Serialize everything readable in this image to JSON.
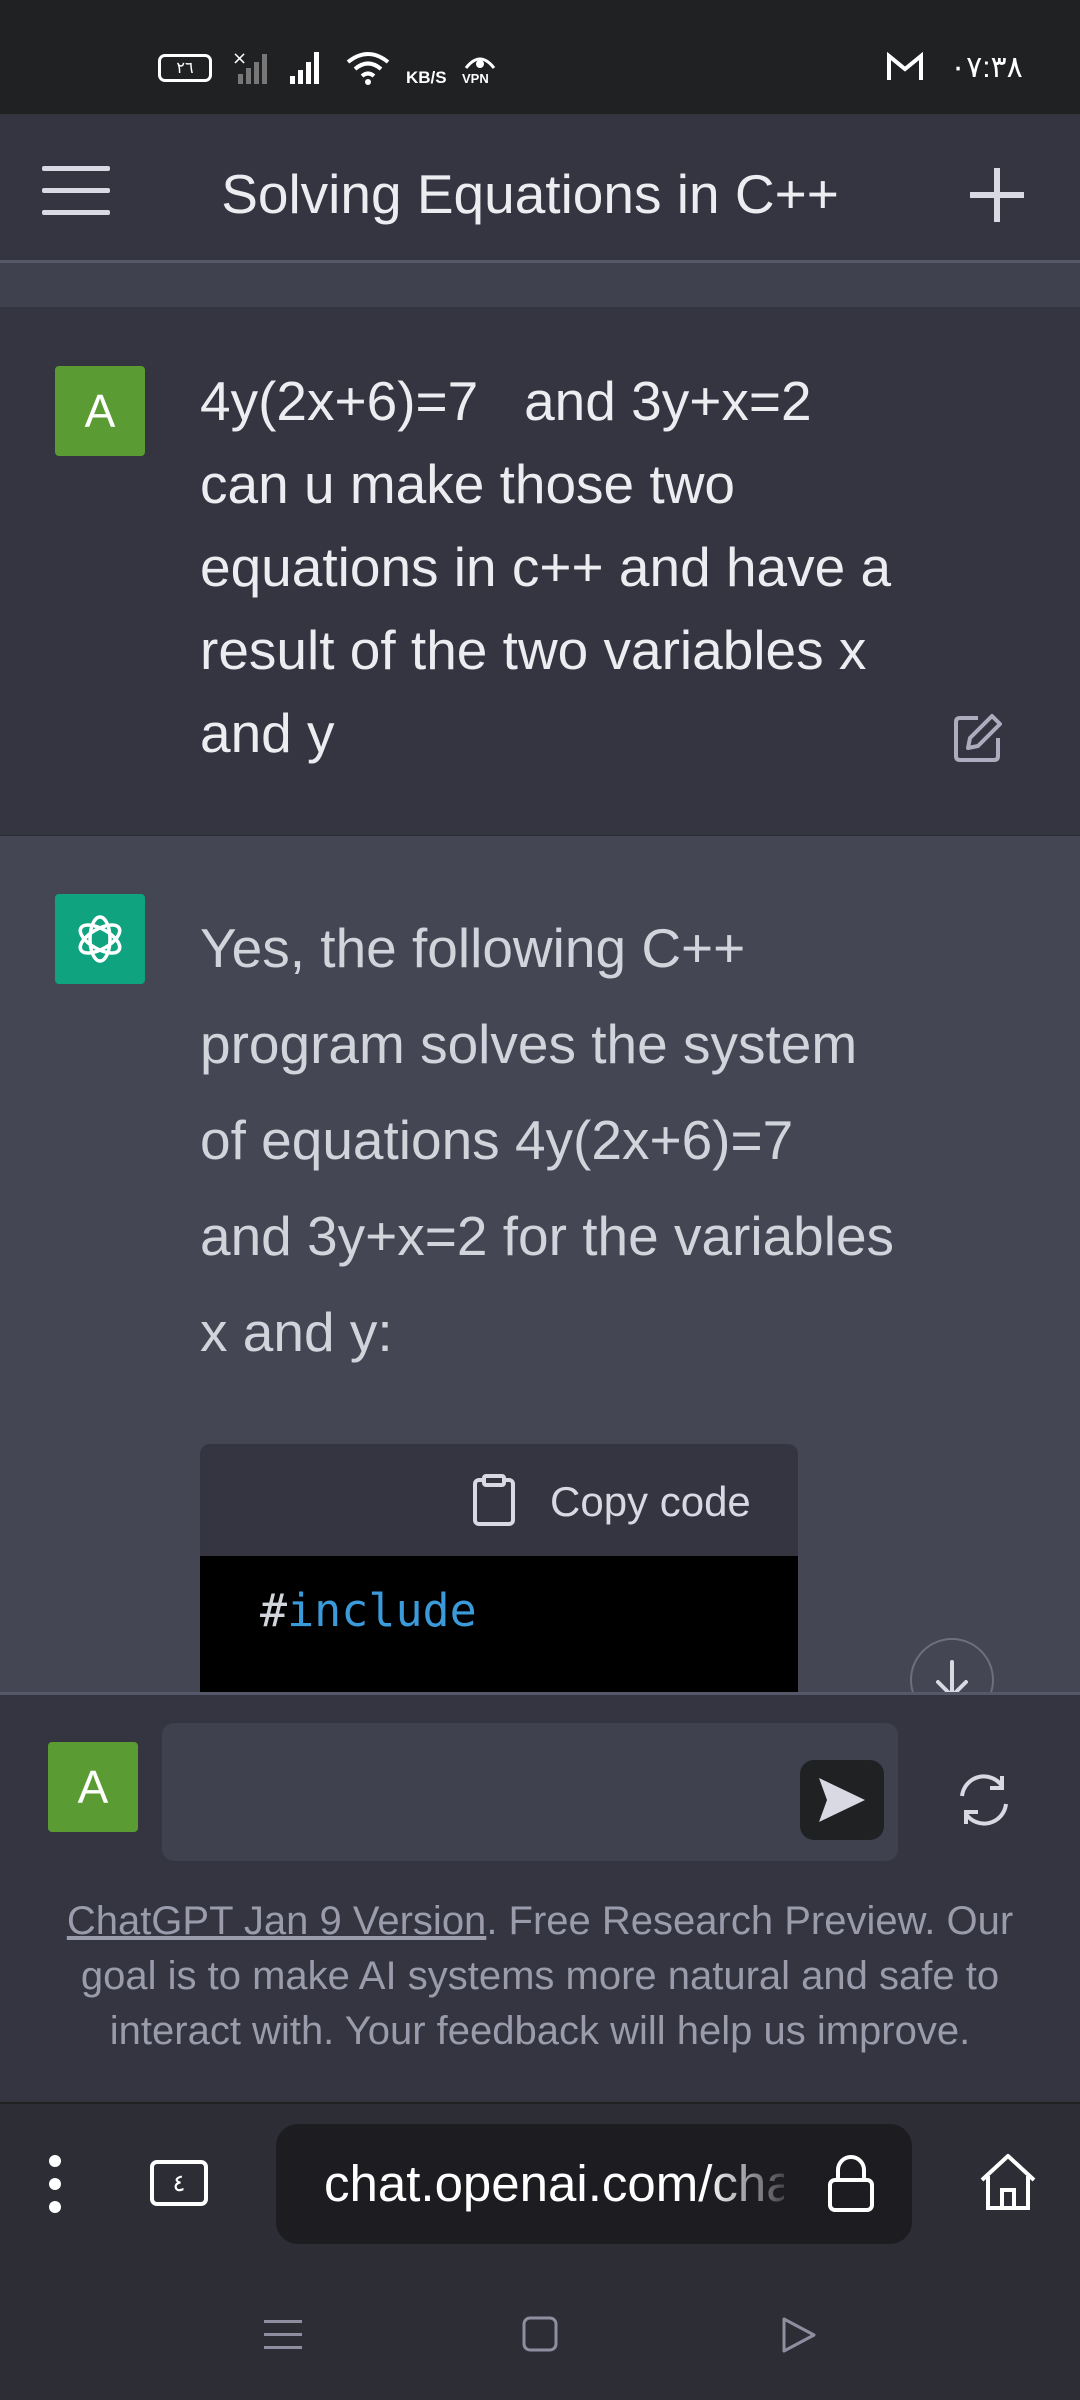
{
  "status_bar": {
    "battery": "٢٦",
    "network_speed": "KB/S",
    "vpn_label": "VPN",
    "time": "٠٧:٣٨",
    "icons": [
      "battery-icon",
      "signal-off-icon",
      "signal-icon",
      "wifi-icon",
      "vpn-icon",
      "gmail-icon"
    ]
  },
  "header": {
    "title": "Solving Equations in C++",
    "icons": [
      "menu-icon",
      "new-chat-icon"
    ]
  },
  "conversation": {
    "user_avatar": "A",
    "user_message": "4y(2x+6)=7   and 3y+x=2\ncan u make those two\nequations in c++ and have a\nresult of the two variables x\nand y",
    "assistant_message": "Yes, the following C++ program solves the system of equations 4y(2x+6)=7 and 3y+x=2 for the variables x and y:",
    "code_block": {
      "copy_label": "Copy code",
      "hash": "#",
      "keyword": "include"
    }
  },
  "composer": {
    "avatar": "A",
    "placeholder": ""
  },
  "disclaimer": {
    "link_text": "ChatGPT Jan 9 Version",
    "text": ". Free Research Preview. Our goal is to make AI systems more natural and safe to interact with. Your feedback will help us improve."
  },
  "browser": {
    "tab_count_glyph": "٤",
    "url": "chat.openai.com/chat"
  },
  "colors": {
    "user_avatar": "#5a9b33",
    "assistant_avatar": "#10a37f",
    "code_keyword": "#3b9ad9"
  }
}
